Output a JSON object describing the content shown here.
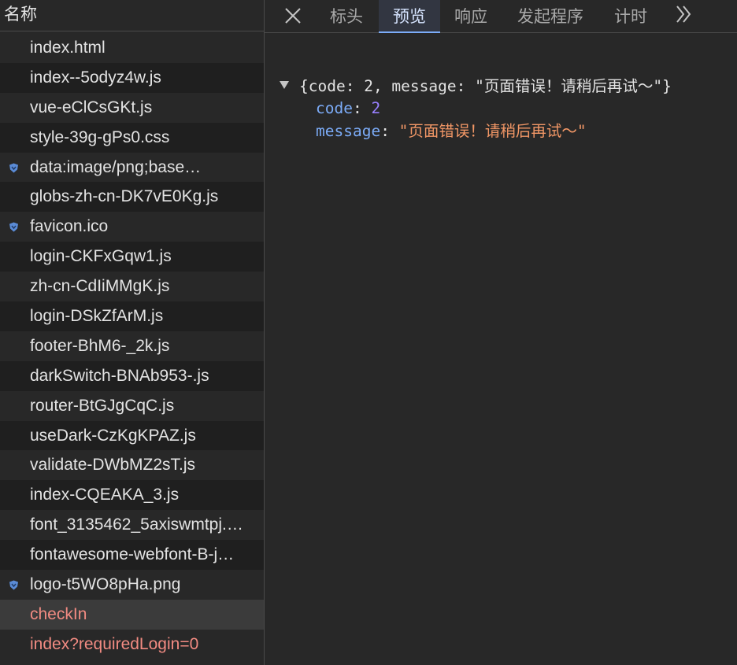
{
  "list": {
    "header": "名称",
    "rows": [
      {
        "name": "index.html",
        "icon": null,
        "state": "normal"
      },
      {
        "name": "index--5odyz4w.js",
        "icon": null,
        "state": "normal"
      },
      {
        "name": "vue-eClCsGKt.js",
        "icon": null,
        "state": "normal"
      },
      {
        "name": "style-39g-gPs0.css",
        "icon": null,
        "state": "normal"
      },
      {
        "name": "data:image/png;base…",
        "icon": "shield-icon",
        "state": "normal"
      },
      {
        "name": "globs-zh-cn-DK7vE0Kg.js",
        "icon": null,
        "state": "normal"
      },
      {
        "name": "favicon.ico",
        "icon": "shield-icon",
        "state": "normal"
      },
      {
        "name": "login-CKFxGqw1.js",
        "icon": null,
        "state": "normal"
      },
      {
        "name": "zh-cn-CdIiMMgK.js",
        "icon": null,
        "state": "normal"
      },
      {
        "name": "login-DSkZfArM.js",
        "icon": null,
        "state": "normal"
      },
      {
        "name": "footer-BhM6-_2k.js",
        "icon": null,
        "state": "normal"
      },
      {
        "name": "darkSwitch-BNAb953-.js",
        "icon": null,
        "state": "normal"
      },
      {
        "name": "router-BtGJgCqC.js",
        "icon": null,
        "state": "normal"
      },
      {
        "name": "useDark-CzKgKPAZ.js",
        "icon": null,
        "state": "normal"
      },
      {
        "name": "validate-DWbMZ2sT.js",
        "icon": null,
        "state": "normal"
      },
      {
        "name": "index-CQEAKA_3.js",
        "icon": null,
        "state": "normal"
      },
      {
        "name": "font_3135462_5axiswmtpj.…",
        "icon": null,
        "state": "normal"
      },
      {
        "name": "fontawesome-webfont-B-j…",
        "icon": null,
        "state": "normal"
      },
      {
        "name": "logo-t5WO8pHa.png",
        "icon": "shield-icon",
        "state": "normal"
      },
      {
        "name": "checkIn",
        "icon": null,
        "state": "selected-error"
      },
      {
        "name": "index?requiredLogin=0",
        "icon": null,
        "state": "error"
      }
    ]
  },
  "detail": {
    "tabs": [
      {
        "label": "标头",
        "active": false
      },
      {
        "label": "预览",
        "active": true
      },
      {
        "label": "响应",
        "active": false
      },
      {
        "label": "发起程序",
        "active": false
      },
      {
        "label": "计时",
        "active": false
      }
    ],
    "preview": {
      "summary_open": "{code: ",
      "summary_code": "2",
      "summary_mid": ", message: ",
      "summary_msg": "\"页面错误！请稍后再试～\"",
      "summary_close": "}",
      "prop_code_key": "code",
      "prop_code_val": "2",
      "prop_msg_key": "message",
      "prop_msg_val": "\"页面错误！请稍后再试～\"",
      "colon": ": "
    }
  },
  "colors": {
    "background": "#282828",
    "key": "#7cacf8",
    "number": "#9980ff",
    "string": "#f29766",
    "error_row": "#f28b82"
  }
}
